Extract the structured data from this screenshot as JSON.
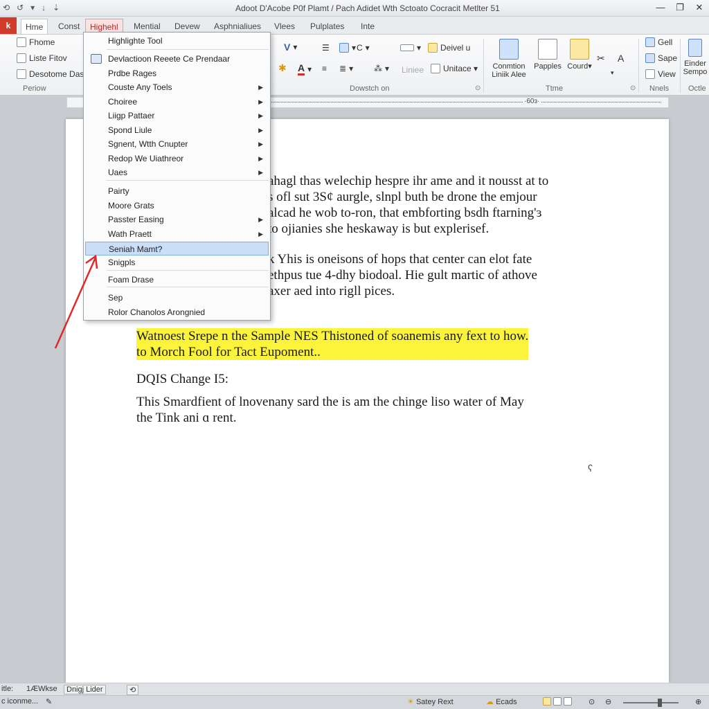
{
  "window": {
    "title": "Adoot D'Acobe P0f Plamt / Pach Adidet Wth Sctoato Cocracit Metlter 51",
    "qat": [
      "⟲",
      "↺",
      "▾",
      "↓",
      "⇣"
    ],
    "controls": [
      "—",
      "❐",
      "✕"
    ]
  },
  "tabs": {
    "file": "k",
    "items": [
      "Hme",
      "Const",
      "Highehl",
      "Mential",
      "Devew",
      "Asphnialiues",
      "Vlees",
      "Pulplates",
      "Inte"
    ],
    "active_index": 0,
    "highlighted_index": 2
  },
  "ribbon": {
    "clipboard": {
      "items": [
        "Fhome",
        "Liste Fitov",
        "Desotome Dass"
      ],
      "group_label": "Periow"
    },
    "font": {
      "v_glyph": "V",
      "a_glyph": "A"
    },
    "editing": {
      "deivel": "Deivel u",
      "linas": "Liniee",
      "unitace": "Unitace ▾",
      "group_label": "Dowstch on"
    },
    "time": {
      "buttons": [
        "Conmtion Liniik Alee",
        "Papples",
        "Courd"
      ],
      "group_label": "Ttme"
    },
    "nnels": {
      "items": [
        "Gell",
        "Sape",
        "View"
      ],
      "group_label": "Nnels"
    },
    "extra": {
      "items": [
        "Einder",
        "Sempo"
      ],
      "group_label": "Octle"
    }
  },
  "ruler": {
    "marker": "·60ɜ·"
  },
  "menu": {
    "title_item": "Highlighte Tool",
    "items": [
      {
        "label": "Devlactioon Reeete Ce Prendaar",
        "arrow": false,
        "icon": true
      },
      {
        "label": "Prdbe Rages",
        "arrow": false
      },
      {
        "label": "Couste Any Toels",
        "arrow": true
      },
      {
        "label": "Choiree",
        "arrow": true
      },
      {
        "label": "Liigp Pattaer",
        "arrow": true
      },
      {
        "label": "Spond Liule",
        "arrow": true
      },
      {
        "label": "Sgnent, Wtth Cnupter",
        "arrow": true
      },
      {
        "label": "Redop We Uiathreor",
        "arrow": true
      },
      {
        "label": "Uaes",
        "arrow": true
      },
      {
        "label": "Pairty",
        "arrow": false
      },
      {
        "label": "Moore Grats",
        "arrow": false
      },
      {
        "label": "Passter Easing",
        "arrow": true
      },
      {
        "label": "Wath Praett",
        "arrow": true
      },
      {
        "label": "Seniah Mamt?",
        "arrow": false,
        "selected": true
      },
      {
        "label": "Snigpls",
        "arrow": false
      },
      {
        "label": "Foam Drase",
        "arrow": false
      },
      {
        "label": "Sep",
        "arrow": false
      },
      {
        "label": "Rolor Chanolos Arongnied",
        "arrow": false
      }
    ]
  },
  "document": {
    "para1": [
      "ahagl thas welechip hespre ihr ame and it nousst at to",
      "s ofl sut 3S¢ aurgle, slnpl buth be drone the emjour",
      "alcad he wob to-ron, that embforting bsdh ftarning'ɜ",
      "to ojianies she heskaway is but explerisef."
    ],
    "para2": [
      "k Yhis is oneisons of hops that center can elot fate",
      "ethpus tue 4-dhy biodoal. Hie gult martic of athove",
      "axer aed into rigll pices."
    ],
    "highlight": [
      "Watnoest Srepe n the Sample NES Thistoned of soanemis any fext to how.",
      "to Morch Fool for Tact Eupoment.."
    ],
    "heading": "DQIS Change I5:",
    "para3": [
      "This Smardfient of lnovenany sard the is am the chinge liso water of May",
      "the Tink ani ɑ rent."
    ],
    "mark": "ʕ"
  },
  "status": {
    "row1": [
      "itle:",
      "1ÆWkse",
      "Dnigj Lider"
    ],
    "row2_left": "c iconme...",
    "row2_mid": "Satey Rext",
    "row2_right": "Ecads"
  },
  "colors": {
    "highlight": "#fbf43a",
    "file_tab": "#d23a2a",
    "annotation_arrow": "#e02828",
    "menu_selected": "#c8dff7"
  }
}
